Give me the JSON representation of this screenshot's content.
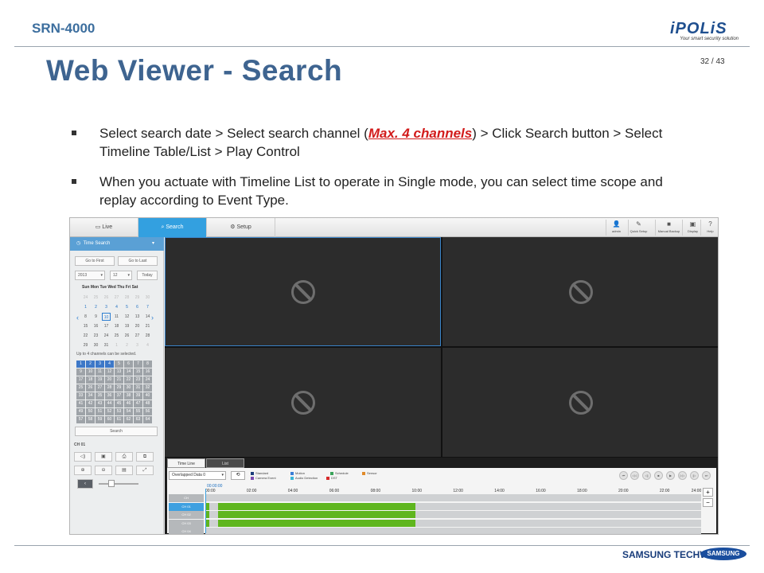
{
  "header": {
    "model": "SRN-4000",
    "brand": "iPOLiS",
    "brand_tagline": "Your smart security solution",
    "title": "Web Viewer - Search",
    "page": "32 / 43"
  },
  "bullets": [
    {
      "pre": "Select search date > Select search channel (",
      "highlight": "Max. 4 channels",
      "post": ") > Click Search button > Select Timeline Table/List  > Play Control"
    },
    {
      "text": "When you actuate with Timeline List  to operate in Single mode, you can select time scope and replay according to Event Type."
    }
  ],
  "footer": {
    "brand": "SAMSUNG TECHWIN",
    "logo": "SAMSUNG"
  },
  "viewer": {
    "tabs": [
      {
        "label": "Live",
        "icon": "monitor-icon"
      },
      {
        "label": "Search",
        "icon": "search-icon"
      },
      {
        "label": "Setup",
        "icon": "gear-icon"
      }
    ],
    "toolbar": [
      {
        "label": "admin",
        "icon": "user-icon"
      },
      {
        "label": "Quick Setup",
        "icon": "wrench-icon"
      },
      {
        "label": "Manual Backup",
        "icon": "camera-icon"
      },
      {
        "label": "Display",
        "icon": "display-icon"
      },
      {
        "label": "Help",
        "icon": "help-icon"
      }
    ],
    "left": {
      "time_search": "Time Search",
      "go_first": "Go to First",
      "go_last": "Go to Last",
      "year": "2013",
      "month": "12",
      "today": "Today",
      "weekdays": "Sun Mon Tue Wed Thu  Fri  Sat",
      "channel_note": "Up to 4 channels can be selected.",
      "search": "Search",
      "ch_label": "CH 01"
    },
    "timeline": {
      "tab_timeline": "Time Line",
      "tab_list": "List",
      "overlap": "Overlapped Data 0",
      "legend": [
        {
          "label": "Standard",
          "color": "#1a3d7a"
        },
        {
          "label": "Motion",
          "color": "#3a7ed6"
        },
        {
          "label": "Schedule",
          "color": "#3aa35a"
        },
        {
          "label": "Sensor",
          "color": "#e08a2a"
        },
        {
          "label": "Camera Event",
          "color": "#7a4ab0"
        },
        {
          "label": "Audio Detection",
          "color": "#3ab5d6"
        },
        {
          "label": "DST",
          "color": "#d62a2a"
        }
      ],
      "current_time": "00:00:00",
      "hours": [
        "00:00",
        "02:00",
        "04:00",
        "06:00",
        "08:00",
        "10:00",
        "12:00",
        "14:00",
        "16:00",
        "18:00",
        "20:00",
        "22:00",
        "24:00"
      ],
      "rows": [
        "CH",
        "CH 01",
        "CH 02",
        "CH 03",
        "CH 04"
      ]
    }
  }
}
